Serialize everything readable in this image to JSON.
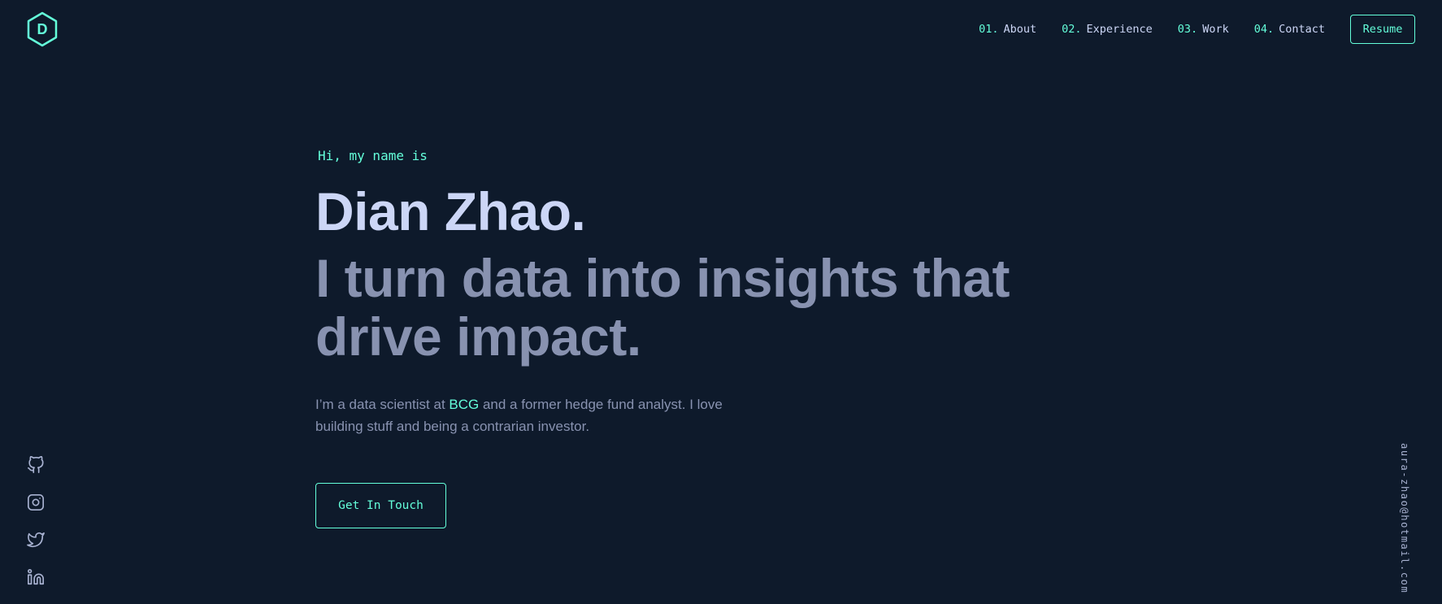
{
  "logo": {
    "letter": "D",
    "icon": "hexagon-logo-icon",
    "color": "#64ffda"
  },
  "nav": {
    "items": [
      {
        "num": "01.",
        "label": "About"
      },
      {
        "num": "02.",
        "label": "Experience"
      },
      {
        "num": "03.",
        "label": "Work"
      },
      {
        "num": "04.",
        "label": "Contact"
      }
    ],
    "resume_label": "Resume"
  },
  "hero": {
    "greeting": "Hi, my name is",
    "name": "Dian Zhao.",
    "tagline": "I turn data into insights that drive impact.",
    "intro_prefix": "I’m a data scientist at ",
    "intro_highlight": "BCG",
    "intro_suffix": " and a former hedge fund analyst. I love building stuff and being a contrarian investor.",
    "cta_label": "Get In Touch"
  },
  "socials": [
    {
      "name": "github-icon"
    },
    {
      "name": "instagram-icon"
    },
    {
      "name": "twitter-icon"
    },
    {
      "name": "linkedin-icon"
    }
  ],
  "email": "aura-zhao@hotmail.com",
  "colors": {
    "background": "#0e1a2b",
    "accent": "#64ffda",
    "heading": "#ccd6f6",
    "body": "#8892b0",
    "icon": "#a8b2d1"
  }
}
